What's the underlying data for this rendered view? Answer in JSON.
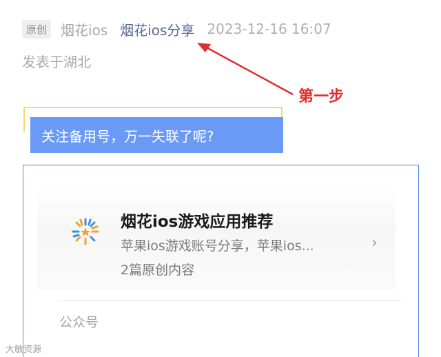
{
  "meta": {
    "badge": "原创",
    "author_plain": "烟花ios",
    "author_link": "烟花ios分享",
    "datetime": "2023-12-16 16:07",
    "location": "发表于湖北"
  },
  "annotation": {
    "step_label": "第一步",
    "color": "#e02c2c"
  },
  "follow_banner": {
    "text": "关注备用号，万一失联了呢?",
    "color": "#6a9af5"
  },
  "account_card": {
    "name": "烟花ios游戏应用推荐",
    "description": "苹果ios游戏账号分享，苹果ios...",
    "count": "2篇原创内容",
    "footer": "公众号",
    "logo_icon": "firework-icon",
    "chevron_icon": "chevron-right-icon",
    "chevron": "›"
  },
  "watermark": "大敏资源"
}
